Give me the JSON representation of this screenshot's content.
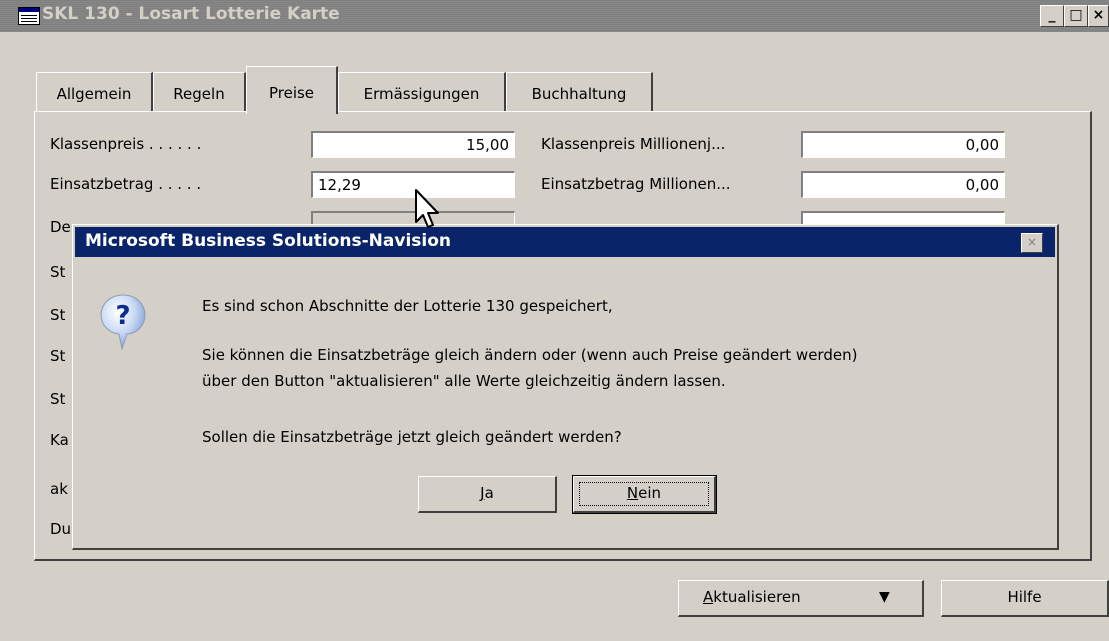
{
  "window": {
    "title": "SKL 130 - Losart Lotterie Karte",
    "controls": {
      "minimize": "_",
      "maximize": "□",
      "close": "×"
    }
  },
  "tabs": [
    {
      "label": "Allgemein"
    },
    {
      "label": "Regeln"
    },
    {
      "label": "Preise",
      "active": true
    },
    {
      "label": "Ermässigungen"
    },
    {
      "label": "Buchhaltung"
    }
  ],
  "form": {
    "left": [
      {
        "label": "Klassenpreis . . . . . .",
        "value": "15,00"
      },
      {
        "label": "Einsatzbetrag . . . . .",
        "value": "12,29"
      },
      {
        "label": "De",
        "value": ""
      },
      {
        "label": "St"
      },
      {
        "label": "St"
      },
      {
        "label": "St"
      },
      {
        "label": "St"
      },
      {
        "label": "Ka"
      },
      {
        "label": "ak"
      },
      {
        "label": "Du"
      }
    ],
    "right": [
      {
        "label": "Klassenpreis Millionenj...",
        "value": "0,00"
      },
      {
        "label": "Einsatzbetrag Millionen...",
        "value": "0,00"
      }
    ]
  },
  "dialog": {
    "title": "Microsoft Business Solutions-Navision",
    "icon": "question-icon",
    "close": "×",
    "messages": [
      "Es sind schon Abschnitte der Lotterie 130 gespeichert,",
      "Sie können die Einsatzbeträge gleich ändern oder (wenn auch Preise geändert werden)",
      "über den Button \"aktualisieren\" alle Werte gleichzeitig ändern lassen.",
      "Sollen die Einsatzbeträge jetzt gleich geändert werden?"
    ],
    "yes_button": {
      "mnemonic": "J",
      "rest": "a"
    },
    "no_button": {
      "mnemonic": "N",
      "rest": "ein"
    }
  },
  "footer": {
    "update_button": {
      "mnemonic": "A",
      "rest": "ktualisieren",
      "arrow": "▼"
    },
    "help_button": "Hilfe"
  },
  "colors": {
    "face": "#d4d0c8",
    "active_title": "#0a246a",
    "inactive_title": "#808080"
  }
}
